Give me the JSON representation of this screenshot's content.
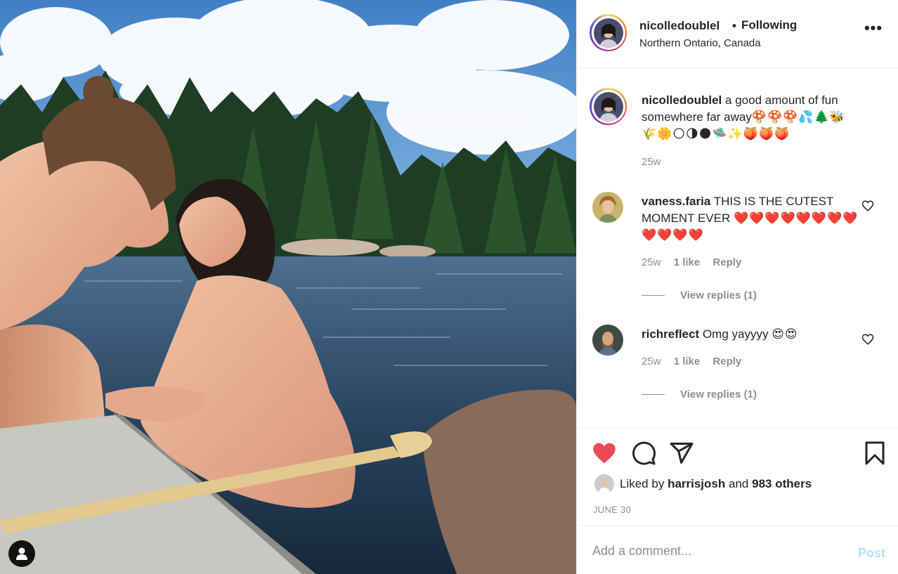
{
  "post": {
    "author": "nicolledoublel",
    "follow_separator": "•",
    "follow_label": "Following",
    "location": "Northern Ontario, Canada",
    "more_label": "•••"
  },
  "caption": {
    "username": "nicolledoublel",
    "text": "a good amount of fun somewhere far away",
    "emojis": "🍄🍄🍄💦🌲🐝🌾🌼🌕🌗🌑🛸✨🍑🍑🍑",
    "time": "25w"
  },
  "comments": [
    {
      "username": "vaness.faria",
      "text": "THIS IS THE CUTEST MOMENT EVER",
      "emojis": "❤️❤️❤️❤️❤️❤️❤️❤️❤️❤️❤️❤️",
      "time": "25w",
      "likes": "1 like",
      "reply_label": "Reply",
      "view_replies": "View replies (1)"
    },
    {
      "username": "richreflect",
      "text": "Omg yayyyy",
      "emojis": "😍😍",
      "time": "25w",
      "likes": "1 like",
      "reply_label": "Reply",
      "view_replies": "View replies (1)"
    }
  ],
  "actions": {
    "liked": true,
    "like_icon": "heart-filled-icon",
    "comment_icon": "speech-bubble-icon",
    "share_icon": "paper-plane-icon",
    "save_icon": "bookmark-icon",
    "liked_by_prefix": "Liked by",
    "liked_by_user": "harrisjosh",
    "liked_by_and": "and",
    "liked_by_others": "983 others",
    "date": "JUNE 30"
  },
  "add_comment": {
    "placeholder": "Add a comment...",
    "post_label": "Post"
  },
  "colors": {
    "like_red": "#ed4956",
    "post_disabled": "#b2dffc",
    "muted": "#8e8e8e",
    "text": "#262626"
  }
}
